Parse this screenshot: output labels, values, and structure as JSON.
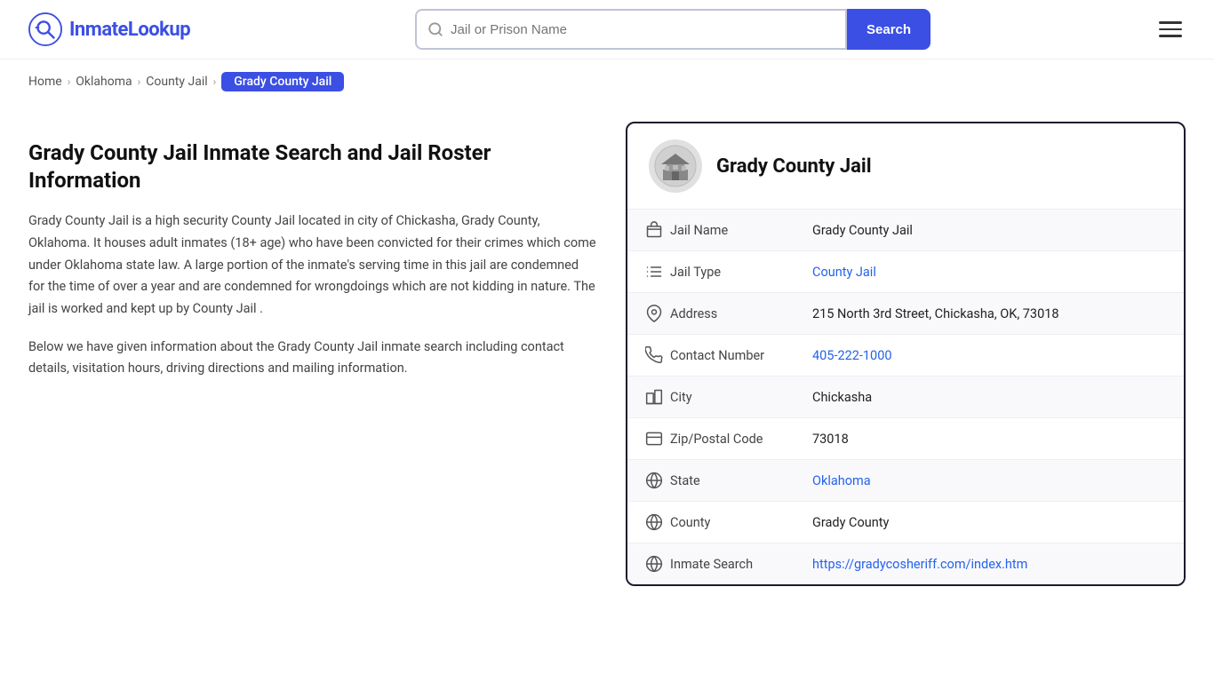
{
  "header": {
    "logo_text_regular": "Inmate",
    "logo_text_accent": "Lookup",
    "search_placeholder": "Jail or Prison Name",
    "search_button_label": "Search",
    "menu_label": "Menu"
  },
  "breadcrumb": {
    "items": [
      {
        "label": "Home",
        "href": "/"
      },
      {
        "label": "Oklahoma",
        "href": "/oklahoma"
      },
      {
        "label": "County Jail",
        "href": "/oklahoma/county-jail"
      }
    ],
    "current": "Grady County Jail"
  },
  "left": {
    "title": "Grady County Jail Inmate Search and Jail Roster Information",
    "description1": "Grady County Jail is a high security County Jail located in city of Chickasha, Grady County, Oklahoma. It houses adult inmates (18+ age) who have been convicted for their crimes which come under Oklahoma state law. A large portion of the inmate's serving time in this jail are condemned for the time of over a year and are condemned for wrongdoings which are not kidding in nature. The jail is worked and kept up by County Jail .",
    "description2": "Below we have given information about the Grady County Jail inmate search including contact details, visitation hours, driving directions and mailing information."
  },
  "card": {
    "title": "Grady County Jail",
    "rows": [
      {
        "label": "Jail Name",
        "value": "Grady County Jail",
        "link": null,
        "icon": "jail-icon"
      },
      {
        "label": "Jail Type",
        "value": "County Jail",
        "link": "#",
        "icon": "type-icon"
      },
      {
        "label": "Address",
        "value": "215 North 3rd Street, Chickasha, OK, 73018",
        "link": null,
        "icon": "address-icon"
      },
      {
        "label": "Contact Number",
        "value": "405-222-1000",
        "link": "tel:405-222-1000",
        "icon": "phone-icon"
      },
      {
        "label": "City",
        "value": "Chickasha",
        "link": null,
        "icon": "city-icon"
      },
      {
        "label": "Zip/Postal Code",
        "value": "73018",
        "link": null,
        "icon": "zip-icon"
      },
      {
        "label": "State",
        "value": "Oklahoma",
        "link": "#",
        "icon": "state-icon"
      },
      {
        "label": "County",
        "value": "Grady County",
        "link": null,
        "icon": "county-icon"
      },
      {
        "label": "Inmate Search",
        "value": "https://gradycosheriff.com/index.htm",
        "link": "https://gradycosheriff.com/index.htm",
        "icon": "search-link-icon"
      }
    ]
  },
  "colors": {
    "accent": "#3b4fe4",
    "dark": "#1a1a2e",
    "link": "#2563eb"
  }
}
